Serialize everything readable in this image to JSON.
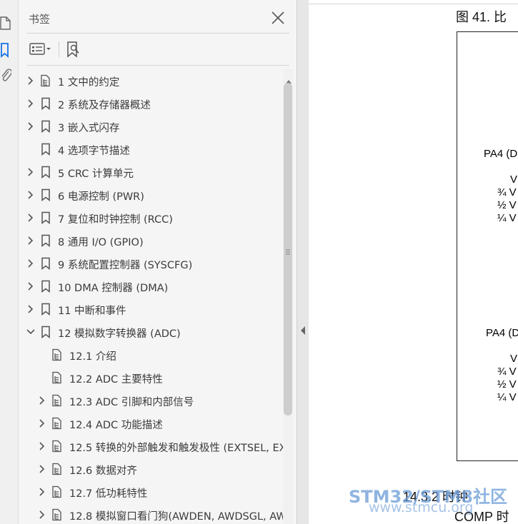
{
  "panel": {
    "title": "书签"
  },
  "bookmarks": [
    {
      "label": "1 文中的约定",
      "expandable": true,
      "icon": "outline-icon",
      "level": 0
    },
    {
      "label": "2 系统及存储器概述",
      "expandable": true,
      "icon": "bookmark-icon",
      "level": 0
    },
    {
      "label": "3 嵌入式闪存",
      "expandable": true,
      "icon": "bookmark-icon",
      "level": 0
    },
    {
      "label": "4 选项字节描述",
      "expandable": false,
      "icon": "bookmark-icon",
      "level": 0
    },
    {
      "label": "5 CRC 计算单元",
      "expandable": true,
      "icon": "bookmark-icon",
      "level": 0
    },
    {
      "label": "6 电源控制 (PWR)",
      "expandable": true,
      "icon": "bookmark-icon",
      "level": 0
    },
    {
      "label": "7 复位和时钟控制 (RCC)",
      "expandable": true,
      "icon": "bookmark-icon",
      "level": 0
    },
    {
      "label": "8 通用 I/O (GPIO)",
      "expandable": true,
      "icon": "bookmark-icon",
      "level": 0
    },
    {
      "label": "9 系统配置控制器 (SYSCFG)",
      "expandable": true,
      "icon": "bookmark-icon",
      "level": 0
    },
    {
      "label": "10 DMA 控制器 (DMA)",
      "expandable": true,
      "icon": "bookmark-icon",
      "level": 0
    },
    {
      "label": "11 中断和事件",
      "expandable": true,
      "icon": "bookmark-icon",
      "level": 0
    },
    {
      "label": "12 模拟数字转换器 (ADC)",
      "expandable": true,
      "expanded": true,
      "icon": "bookmark-icon",
      "level": 0
    },
    {
      "label": "12.1 介绍",
      "expandable": false,
      "icon": "outline-icon",
      "level": 1
    },
    {
      "label": "12.2 ADC 主要特性",
      "expandable": false,
      "icon": "outline-icon",
      "level": 1
    },
    {
      "label": "12.3 ADC 引脚和内部信号",
      "expandable": true,
      "icon": "outline-icon",
      "level": 1
    },
    {
      "label": "12.4 ADC 功能描述",
      "expandable": true,
      "icon": "outline-icon",
      "level": 1
    },
    {
      "label": "12.5 转换的外部触发和触发极性 (EXTSEL, EXT",
      "expandable": true,
      "icon": "outline-icon",
      "level": 1
    },
    {
      "label": "12.6 数据对齐",
      "expandable": true,
      "icon": "outline-icon",
      "level": 1
    },
    {
      "label": "12.7 低功耗特性",
      "expandable": true,
      "icon": "outline-icon",
      "level": 1
    },
    {
      "label": "12.8 模拟窗口看门狗(AWDEN, AWDSGL, AWD",
      "expandable": true,
      "icon": "outline-icon",
      "level": 1
    }
  ],
  "document": {
    "figure_caption": "图 41. 比",
    "labels": [
      "PA4 (D",
      "V",
      "¾ V",
      "½ V",
      "¼ V",
      "PA4 (D",
      "V",
      "¾ V",
      "½ V",
      "¼ V"
    ],
    "section_heading": "14.3.2  时钟",
    "section_text": "COMP 时钟",
    "watermark": "STM32/STM8社区",
    "watermark_url": "www.stmcu.org"
  },
  "colors": {
    "rail_active": "#1473e6",
    "watermark": "#6a9bd8"
  }
}
